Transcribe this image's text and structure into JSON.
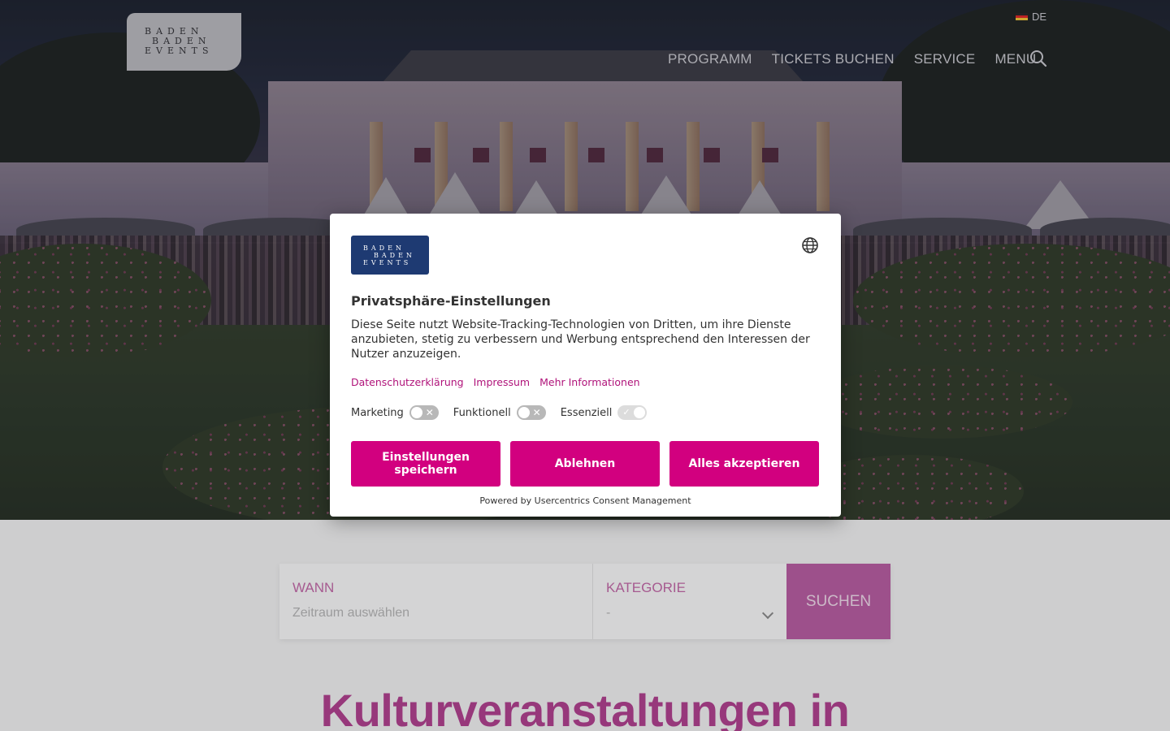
{
  "header": {
    "logo_lines": [
      "BADEN",
      "BADEN",
      "EVENTS"
    ],
    "language": "DE",
    "nav": [
      "PROGRAMM",
      "TICKETS BUCHEN",
      "SERVICE",
      "MENU"
    ],
    "search_icon": "search-icon"
  },
  "search_panel": {
    "when_label": "WANN",
    "when_placeholder": "Zeitraum auswählen",
    "category_label": "KATEGORIE",
    "category_value": "-",
    "submit_label": "SUCHEN"
  },
  "main": {
    "heading": "Kulturveranstaltungen in"
  },
  "consent": {
    "logo_lines": [
      "BADEN",
      "BADEN",
      "EVENTS"
    ],
    "title": "Privatsphäre-Einstellungen",
    "body": "Diese Seite nutzt Website-Tracking-Technologien von Dritten, um ihre Dienste anzubieten, stetig zu verbessern und Werbung entsprechend den Interessen der Nutzer anzuzeigen.",
    "links": [
      "Datenschutzerklärung",
      "Impressum",
      "Mehr Informationen"
    ],
    "toggles": [
      {
        "label": "Marketing",
        "on": false
      },
      {
        "label": "Funktionell",
        "on": false
      },
      {
        "label": "Essenziell",
        "on": true,
        "locked": true
      }
    ],
    "buttons": [
      "Einstellungen speichern",
      "Ablehnen",
      "Alles akzeptieren"
    ],
    "powered_by": "Powered by Usercentrics Consent Management"
  },
  "colors": {
    "accent": "#d2007f",
    "brand_blue": "#1e3a72",
    "heading_pink": "#b03c8d"
  }
}
